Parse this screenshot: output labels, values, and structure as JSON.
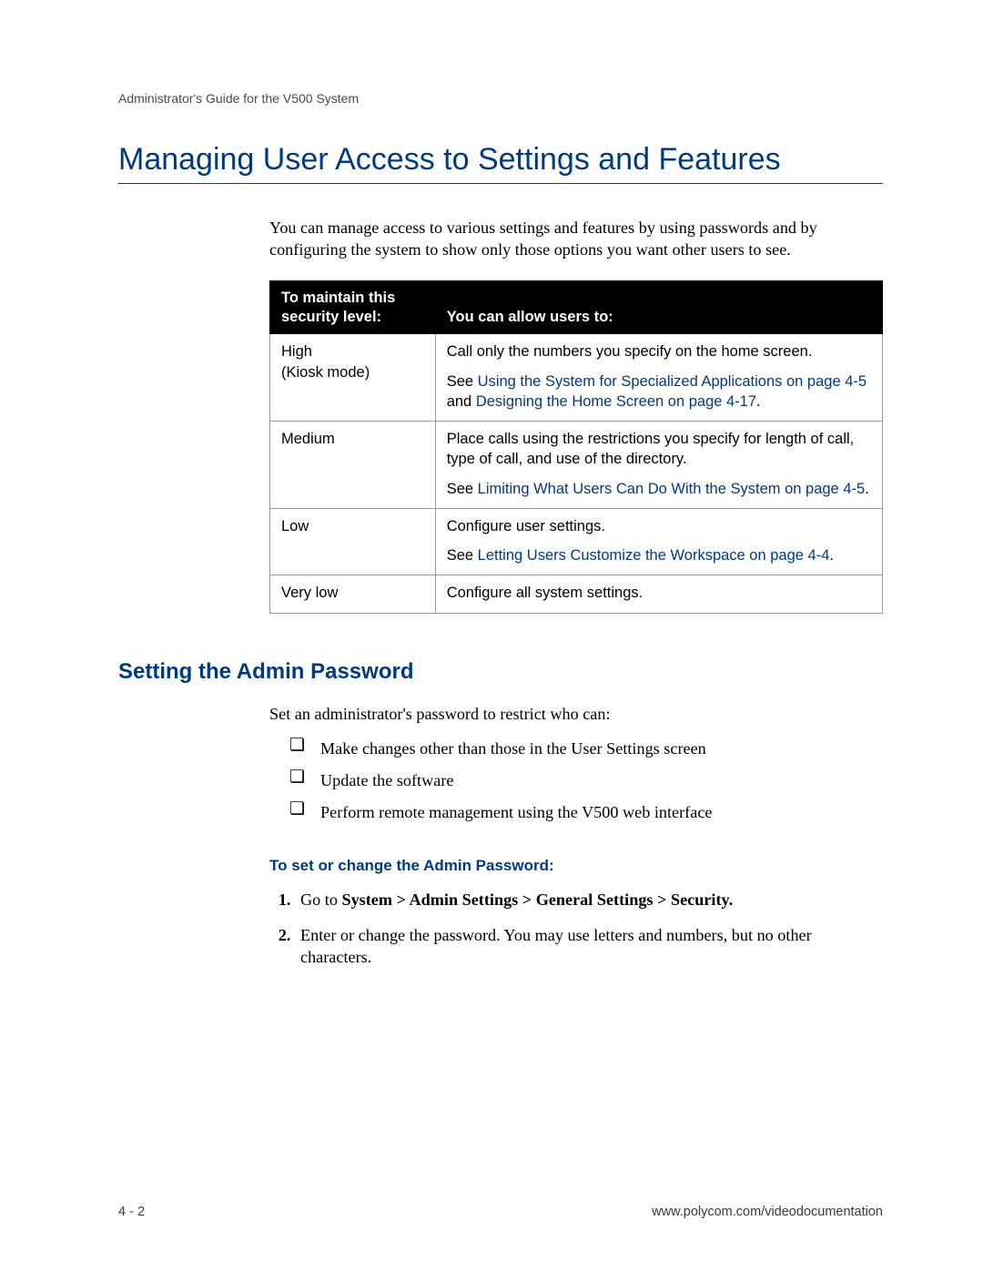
{
  "running_head": "Administrator's Guide for the V500 System",
  "h1": "Managing User Access to Settings and Features",
  "intro": "You can manage access to various settings and features by using passwords and by configuring the system to show only those options you want other users to see.",
  "table": {
    "head_col1_line1": "To maintain this",
    "head_col1_line2": "security level:",
    "head_col2": "You can allow users to:",
    "rows": {
      "r0": {
        "level_line1": "High",
        "level_line2": "(Kiosk mode)",
        "p1": "Call only the numbers you specify on the home screen.",
        "p2_pre": "See ",
        "p2_link1": "Using the System for Specialized Applications on page 4-5",
        "p2_mid": " and ",
        "p2_link2": "Designing the Home Screen on page 4-17",
        "p2_post": "."
      },
      "r1": {
        "level": "Medium",
        "p1": "Place calls using the restrictions you specify for length of call, type of call, and use of the directory.",
        "p2_pre": "See ",
        "p2_link": "Limiting What Users Can Do With the System on page 4-5",
        "p2_post": "."
      },
      "r2": {
        "level": "Low",
        "p1": "Configure user settings.",
        "p2_pre": "See ",
        "p2_link": "Letting Users Customize the Workspace on page 4-4",
        "p2_post": "."
      },
      "r3": {
        "level": "Very low",
        "p1": "Configure all system settings."
      }
    }
  },
  "h2": "Setting the Admin Password",
  "admin_intro": "Set an administrator's password to restrict who can:",
  "bullets": {
    "b0": "Make changes other than those in the User Settings screen",
    "b1": "Update the software",
    "b2": "Perform remote management using the V500 web interface"
  },
  "h4": "To set or change the Admin Password:",
  "steps": {
    "s1_pre": "Go to ",
    "s1_bold": "System > Admin Settings > General Settings > Security.",
    "s2": "Enter or change the password. You may use letters and numbers, but no other characters."
  },
  "footer_left": "4 - 2",
  "footer_right": "www.polycom.com/videodocumentation"
}
